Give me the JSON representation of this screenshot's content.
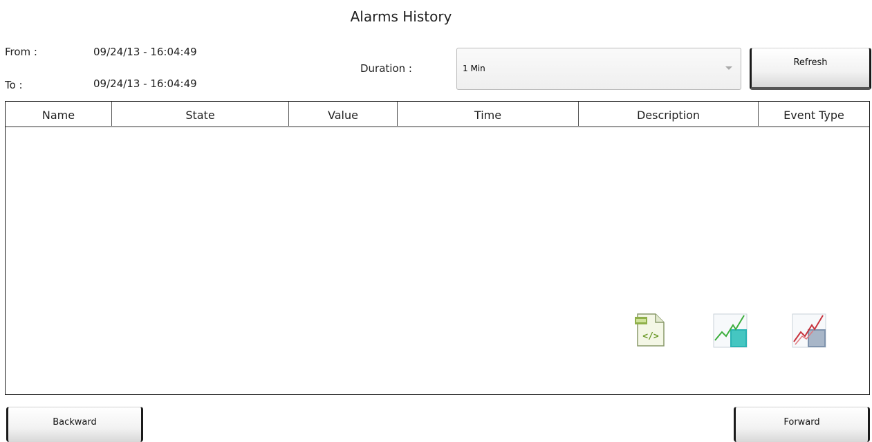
{
  "title": "Alarms History",
  "range": {
    "from_label": "From :",
    "from_value": "09/24/13 - 16:04:49",
    "to_label": "To :",
    "to_value": "09/24/13 - 16:04:49"
  },
  "duration": {
    "label": "Duration :",
    "selected": "1 Min"
  },
  "buttons": {
    "refresh": "Refresh",
    "backward": "Backward",
    "forward": "Forward"
  },
  "table": {
    "columns": [
      "Name",
      "State",
      "Value",
      "Time",
      "Description",
      "Event Type"
    ],
    "rows": []
  },
  "icons": [
    "export-xml-icon",
    "trend-chart-icon",
    "trend-chart-alt-icon"
  ],
  "colors": {
    "border": "#1a1a1a",
    "trend_green": "#3cae3c",
    "trend_teal": "#2bb3b3",
    "trend_red": "#c8323c"
  }
}
